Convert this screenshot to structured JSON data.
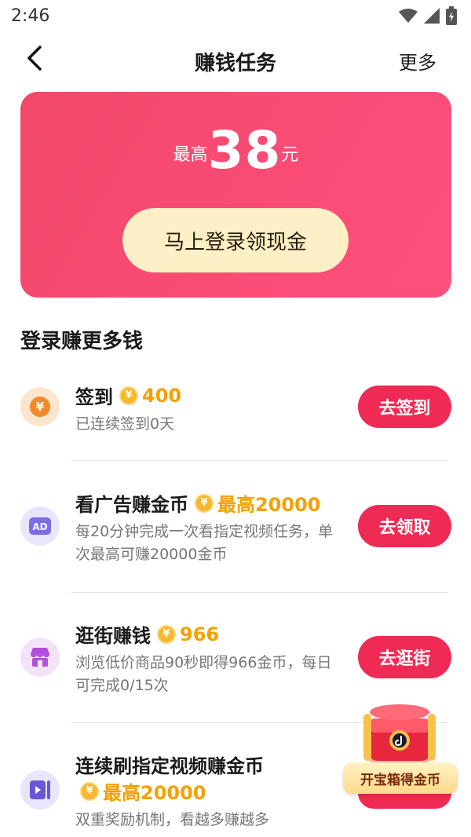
{
  "status_bar": {
    "time": "2:46"
  },
  "nav": {
    "title": "赚钱任务",
    "more": "更多"
  },
  "banner": {
    "prefix": "最高",
    "amount": "38",
    "unit": "元",
    "login_button": "马上登录领现金"
  },
  "section_title": "登录赚更多钱",
  "tasks": [
    {
      "title": "签到",
      "reward": "400",
      "desc": "已连续签到0天",
      "button": "去签到",
      "icon": "yuan-coin-icon",
      "icon_bg": "#fde4cc",
      "icon_color": "#f08a2a"
    },
    {
      "title": "看广告赚金币",
      "reward": "最高20000",
      "desc": "每20分钟完成一次看指定视频任务，单次最高可赚20000金币",
      "button": "去领取",
      "icon": "ad-icon",
      "icon_bg": "#e9e6fb",
      "icon_color": "#7b6ce8"
    },
    {
      "title": "逛街赚钱",
      "reward": "966",
      "desc": "浏览低价商品90秒即得966金币，每日可完成0/15次",
      "button": "去逛街",
      "icon": "shop-icon",
      "icon_bg": "#f3e3fa",
      "icon_color": "#b150dc"
    },
    {
      "title": "连续刷指定视频赚金币",
      "reward": "最高20000",
      "desc": "双重奖励机制，看越多赚越多",
      "button": "",
      "icon": "video-icon",
      "icon_bg": "#e9e6fb",
      "icon_color": "#6a55d8"
    }
  ],
  "treasure": {
    "label": "开宝箱得金币"
  },
  "colors": {
    "accent": "#ee2a55",
    "reward": "#f5a000",
    "banner": "#f2486a"
  }
}
